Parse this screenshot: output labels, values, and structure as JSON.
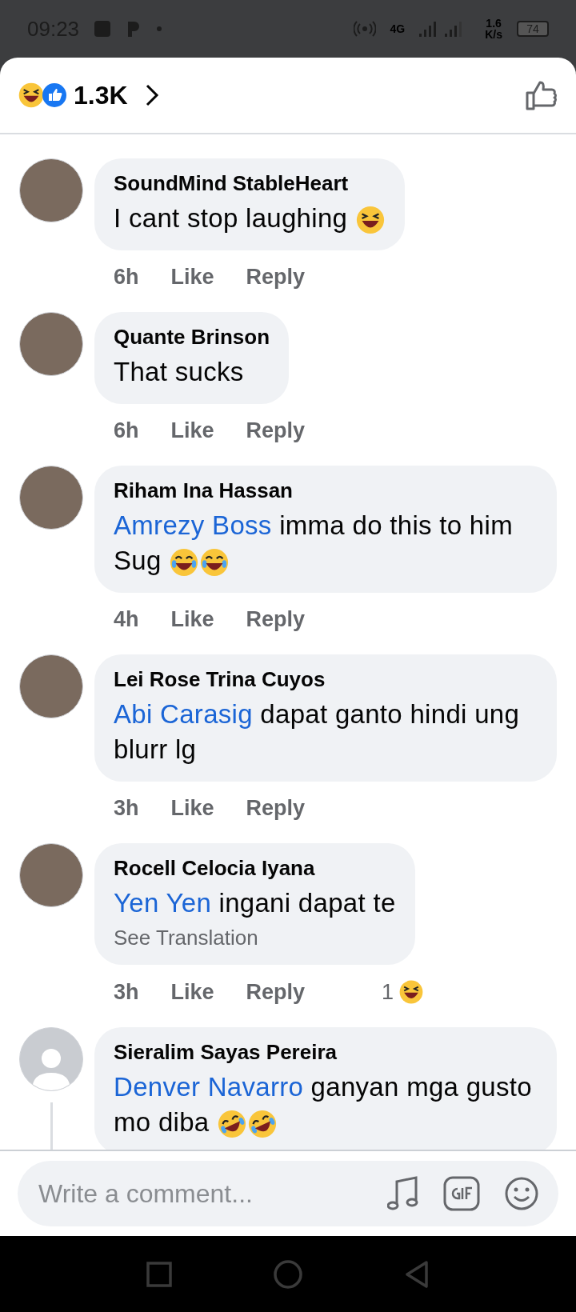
{
  "status_bar": {
    "time": "09:23",
    "network": "4G",
    "speed": "1.6",
    "speed_unit": "K/s",
    "battery": "74"
  },
  "header": {
    "count": "1.3K"
  },
  "comments": [
    {
      "name": "SoundMind StableHeart",
      "avatar_photo": true,
      "text": "I cant stop laughing",
      "emojis": [
        {
          "kind": "squint"
        }
      ],
      "time": "6h",
      "like": "Like",
      "reply": "Reply",
      "has_replies": false
    },
    {
      "name": "Quante Brinson",
      "avatar_photo": true,
      "text": "That sucks",
      "time": "6h",
      "like": "Like",
      "reply": "Reply",
      "has_replies": false
    },
    {
      "name": "Riham Ina Hassan",
      "avatar_photo": true,
      "mention": "Amrezy Boss",
      "text": " imma do this to him Sug",
      "emojis": [
        {
          "kind": "tears"
        },
        {
          "kind": "tears"
        }
      ],
      "time": "4h",
      "like": "Like",
      "reply": "Reply",
      "has_replies": false
    },
    {
      "name": "Lei Rose Trina Cuyos",
      "avatar_photo": true,
      "mention": "Abi Carasig",
      "text": "dapat ganto hindi ung blurr lg",
      "time": "3h",
      "like": "Like",
      "reply": "Reply",
      "has_replies": false
    },
    {
      "name": "Rocell Celocia Iyana",
      "avatar_photo": true,
      "mention": "Yen Yen",
      "text": "ingani dapat te",
      "translation": "See Translation",
      "time": "3h",
      "like": "Like",
      "reply": "Reply",
      "reactions": {
        "count": "1",
        "kind": "squint"
      },
      "has_replies": false
    },
    {
      "name": "Sieralim Sayas Pereira",
      "avatar_photo": false,
      "mention": "Denver Navarro",
      "text": "ganyan mga gusto mo diba",
      "emojis": [
        {
          "kind": "rofl"
        },
        {
          "kind": "rofl"
        }
      ],
      "has_replies": true
    }
  ],
  "composer": {
    "placeholder": "Write a comment..."
  }
}
